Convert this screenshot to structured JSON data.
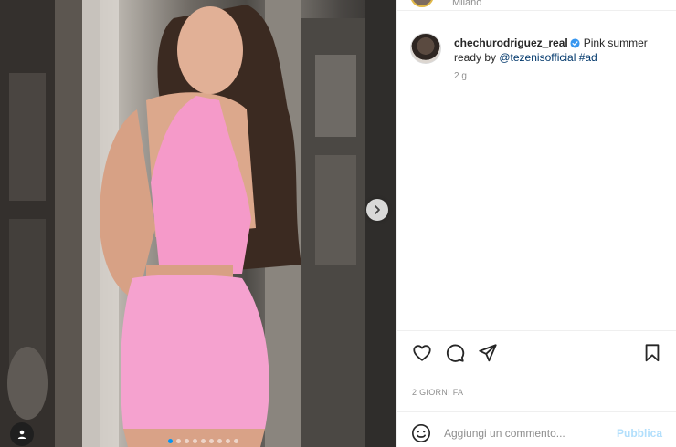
{
  "post": {
    "header": {
      "location": "Milano"
    },
    "caption": {
      "username": "chechurodriguez_real",
      "text_before": "Pink summer ready by ",
      "mention": "@tezenisofficial",
      "space": " ",
      "hashtag": "#ad",
      "time_ago": "2 g"
    },
    "actions": {
      "like_icon": "heart-icon",
      "comment_icon": "comment-icon",
      "share_icon": "send-icon",
      "save_icon": "bookmark-icon"
    },
    "date_label": "2 GIORNI FA",
    "comment_box": {
      "placeholder": "Aggiungi un commento...",
      "publish_label": "Pubblica",
      "emoji_icon": "emoji-icon"
    },
    "carousel": {
      "total_slides": 9,
      "current_slide": 1,
      "next_icon": "chevron-right-icon",
      "tag_icon": "user-tag-icon"
    }
  },
  "colors": {
    "accent_blue": "#0095f6",
    "publish_disabled": "#b2dffc",
    "mention_blue": "#00376b",
    "verified_blue": "#3897f0",
    "outfit_pink": "#f59ac9"
  }
}
